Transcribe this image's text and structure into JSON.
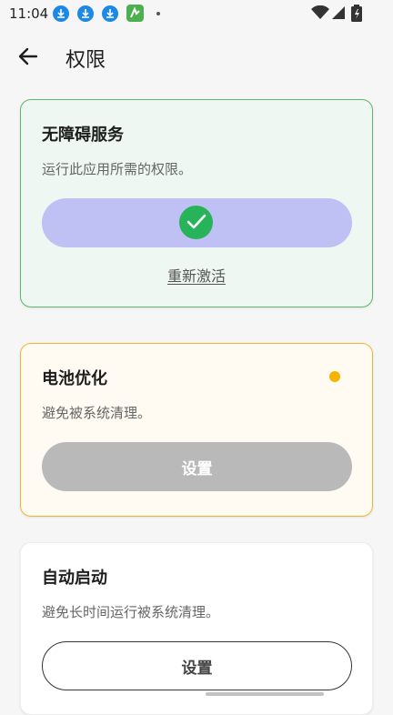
{
  "status_bar": {
    "time": "11:04",
    "icons": [
      "download-icon",
      "download-icon",
      "download-icon",
      "app-notification-icon",
      "dot-icon",
      "wifi-icon",
      "signal-icon",
      "battery-icon"
    ]
  },
  "app_bar": {
    "back_icon": "arrow-left-icon",
    "title": "权限"
  },
  "cards": {
    "accessibility": {
      "title": "无障碍服务",
      "description": "运行此应用所需的权限。",
      "status_icon": "check-icon",
      "link": "重新激活",
      "border_color": "#5cb86a",
      "background": "#eef7f1"
    },
    "battery": {
      "title": "电池优化",
      "description": "避免被系统清理。",
      "indicator_color": "#f5b400",
      "button": "设置",
      "border_color": "#f2b531"
    },
    "autostart": {
      "title": "自动启动",
      "description": "避免长时间运行被系统清理。",
      "button": "设置"
    }
  },
  "colors": {
    "accent_lavender": "#bfc0f3",
    "success_green": "#27b35a",
    "disabled_gray": "#b9b9b9"
  }
}
